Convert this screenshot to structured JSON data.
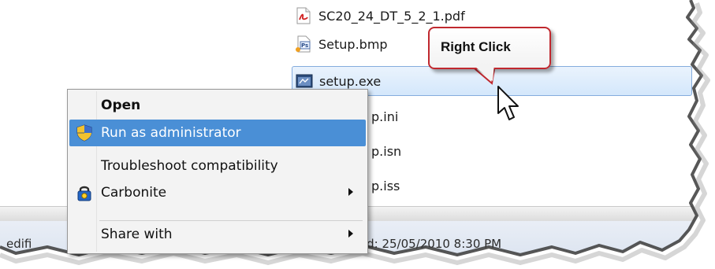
{
  "files": [
    {
      "name": "SC20_24_DT_5_2_1.pdf",
      "icon": "pdf-icon"
    },
    {
      "name": "Setup.bmp",
      "icon": "photoshop-bmp-icon"
    },
    {
      "name": "setup.exe",
      "icon": "exe-icon",
      "selected": true
    },
    {
      "name": "p.ini"
    },
    {
      "name": "p.isn"
    },
    {
      "name": "p.iss"
    }
  ],
  "context_menu": {
    "items": [
      {
        "label": "Open",
        "bold": true
      },
      {
        "label": "Run as administrator",
        "icon": "uac-shield-icon",
        "highlighted": true
      },
      {
        "label": "Troubleshoot compatibility"
      },
      {
        "label": "Carbonite",
        "icon": "carbonite-lock-icon",
        "submenu": true
      },
      {
        "label": "Share with",
        "submenu": true
      }
    ]
  },
  "callout": {
    "label": "Right Click"
  },
  "details": {
    "left_text": "edifi",
    "right_text": "ted: 25/05/2010 8:30 PM"
  },
  "colors": {
    "highlight": "#4a8fd6",
    "selection_border": "#84acdd",
    "callout_border": "#c0282e"
  }
}
